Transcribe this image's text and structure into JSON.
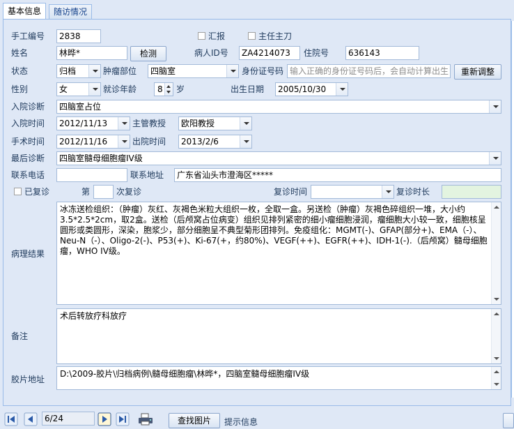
{
  "tabs": [
    {
      "label": "基本信息",
      "active": true
    },
    {
      "label": "随访情况",
      "active": false
    }
  ],
  "form": {
    "manual_no": {
      "label": "手工编号",
      "value": "2838"
    },
    "report_chk": {
      "label": "汇报",
      "checked": false
    },
    "chief_surgeon_chk": {
      "label": "主任主刀",
      "checked": false
    },
    "name": {
      "label": "姓名",
      "value": "林晔*"
    },
    "check_button": "检测",
    "patient_id": {
      "label": "病人ID号",
      "value": "ZA4214073"
    },
    "hospital_no": {
      "label": "住院号",
      "value": "636143"
    },
    "status": {
      "label": "状态",
      "value": "归档"
    },
    "tumor_site": {
      "label": "肿瘤部位",
      "value": "四脑室"
    },
    "id_card": {
      "label": "身份证号码",
      "placeholder": "输入正确的身份证号码后，会自动计算出生日期"
    },
    "readjust_button": "重新调整",
    "gender": {
      "label": "性别",
      "value": "女"
    },
    "visit_age": {
      "label": "就诊年龄",
      "value": "8",
      "unit": "岁"
    },
    "birth_date": {
      "label": "出生日期",
      "value": "2005/10/30"
    },
    "admission_diagnosis": {
      "label": "入院诊断",
      "value": "四脑室占位"
    },
    "admission_time": {
      "label": "入院时间",
      "value": "2012/11/13"
    },
    "attending_prof": {
      "label": "主管教授",
      "value": "欧阳教授"
    },
    "surgery_time": {
      "label": "手术时间",
      "value": "2012/11/16"
    },
    "discharge_time": {
      "label": "出院时间",
      "value": "2013/2/6"
    },
    "final_diagnosis": {
      "label": "最后诊断",
      "value": "四脑室髓母细胞瘤IV级"
    },
    "contact_phone": {
      "label": "联系电话",
      "value": ""
    },
    "contact_address": {
      "label": "联系地址",
      "value": "广东省汕头市澄海区*****"
    },
    "revisited_chk": {
      "label": "已复诊",
      "checked": false
    },
    "revisit_no": {
      "label_pre": "第",
      "value": "",
      "label_post": "次复诊"
    },
    "revisit_time": {
      "label": "复诊时间",
      "value": ""
    },
    "revisit_duration": {
      "label": "复诊时长",
      "value": ""
    },
    "pathology": {
      "label": "病理结果",
      "value": "冰冻送检组织：（肿瘤）灰红、灰褐色米粒大组织一枚，全取一盒。另送检（肿瘤）灰褐色碎组织一堆，大小约3.5*2.5*2cm，取2盒。送检（后颅窝占位病变）组织见排列紧密的细小瘤细胞浸润，瘤细胞大小较一致，细胞核呈圆形或类圆形，深染，胞浆少，部分细胞呈不典型菊形团排列。免疫组化：MGMT(-)、GFAP(部分+)、EMA（-）、Neu-N（-）、Oligo-2(-)、P53(+)、Ki-67(+，约80%)、VEGF(++)、EGFR(++)、IDH-1(-).（后颅窝）髓母细胞瘤，WHO IV级。"
    },
    "remarks": {
      "label": "备注",
      "value": "术后转放疗科放疗"
    },
    "film_path": {
      "label": "胶片地址",
      "value": "D:\\2009-胶片\\归档病例\\髓母细胞瘤\\林晔*，四脑室髓母细胞瘤IV级"
    }
  },
  "navigator": {
    "position": "6/24",
    "find_image_button": "查找图片",
    "hint": "提示信息"
  }
}
